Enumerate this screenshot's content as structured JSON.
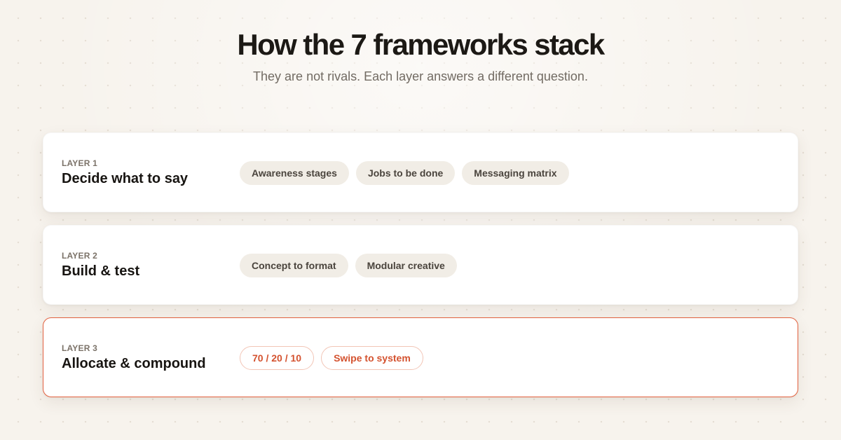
{
  "header": {
    "title": "How the 7 frameworks stack",
    "subtitle": "They are not rivals. Each layer answers a different question."
  },
  "layers": [
    {
      "label": "LAYER 1",
      "name": "Decide what to say",
      "pills": [
        "Awareness stages",
        "Jobs to be done",
        "Messaging matrix"
      ]
    },
    {
      "label": "LAYER 2",
      "name": "Build & test",
      "pills": [
        "Concept to format",
        "Modular creative"
      ]
    },
    {
      "label": "LAYER 3",
      "name": "Allocate & compound",
      "pills": [
        "70 / 20 / 10",
        "Swipe to system"
      ]
    }
  ],
  "colors": {
    "background": "#f7f3ed",
    "accent": "#e2613f",
    "pill_background": "#f1ede6",
    "title_text": "#1c1915"
  }
}
